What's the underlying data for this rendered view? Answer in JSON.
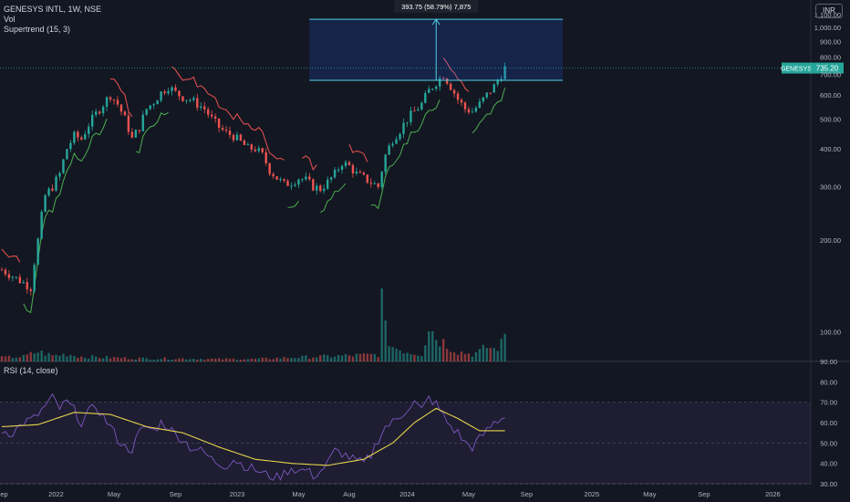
{
  "header": {
    "symbol_line": "GENESYS INTL, 1W, NSE",
    "vol_label": "Vol",
    "supertrend_label": "Supertrend (15, 3)",
    "currency": "INR"
  },
  "measure": {
    "label": "393.75 (58.79%) 7,875",
    "from_price": 670,
    "to_price": 1063
  },
  "price_tag": {
    "symbol": "GENESYS",
    "price": "735.20"
  },
  "colors": {
    "background": "#131722",
    "up": "#26a69a",
    "down": "#ef5350",
    "rsi_line": "#7e57c2",
    "rsi_ma": "#e5d44c",
    "measure": "#4dd0e1",
    "supertrend_up": "#4caf50",
    "supertrend_down": "#ef5350",
    "price_line": "#26a69a"
  },
  "rsi": {
    "label": "RSI (14, close)"
  },
  "chart_data": [
    {
      "type": "candlestick",
      "ylabel": "",
      "ylim": [
        80,
        1230
      ],
      "price_ticks": [
        "100.00",
        "200.00",
        "300.00",
        "400.00",
        "500.00",
        "600.00",
        "700.00",
        "800.00",
        "900.00",
        "1,000.00",
        "1,100.00",
        "1,200.00"
      ],
      "x_ticks": [
        "Sep",
        "2022",
        "May",
        "Sep",
        "2023",
        "May",
        "Aug",
        "2024",
        "May",
        "Sep",
        "2025",
        "May",
        "Sep",
        "2026"
      ],
      "x_tick_weeks": [
        0,
        15,
        31,
        48,
        65,
        82,
        96,
        112,
        129,
        145,
        163,
        179,
        194,
        213
      ],
      "weeks": 224,
      "last_price": 735.2,
      "grid": false,
      "close_points": [
        [
          0,
          160
        ],
        [
          4,
          150
        ],
        [
          8,
          140
        ],
        [
          10,
          200
        ],
        [
          12,
          280
        ],
        [
          14,
          300
        ],
        [
          16,
          330
        ],
        [
          18,
          400
        ],
        [
          20,
          440
        ],
        [
          22,
          430
        ],
        [
          24,
          480
        ],
        [
          26,
          520
        ],
        [
          28,
          560
        ],
        [
          30,
          600
        ],
        [
          32,
          560
        ],
        [
          34,
          500
        ],
        [
          36,
          430
        ],
        [
          38,
          470
        ],
        [
          40,
          540
        ],
        [
          42,
          570
        ],
        [
          44,
          610
        ],
        [
          46,
          640
        ],
        [
          48,
          610
        ],
        [
          50,
          590
        ],
        [
          52,
          580
        ],
        [
          54,
          560
        ],
        [
          56,
          540
        ],
        [
          58,
          500
        ],
        [
          60,
          470
        ],
        [
          62,
          450
        ],
        [
          64,
          440
        ],
        [
          66,
          420
        ],
        [
          68,
          400
        ],
        [
          70,
          400
        ],
        [
          72,
          380
        ],
        [
          74,
          340
        ],
        [
          76,
          320
        ],
        [
          78,
          305
        ],
        [
          80,
          310
        ],
        [
          82,
          320
        ],
        [
          84,
          315
        ],
        [
          86,
          300
        ],
        [
          88,
          295
        ],
        [
          90,
          310
        ],
        [
          92,
          330
        ],
        [
          94,
          360
        ],
        [
          96,
          350
        ],
        [
          98,
          330
        ],
        [
          100,
          320
        ],
        [
          102,
          310
        ],
        [
          104,
          300
        ],
        [
          106,
          380
        ],
        [
          108,
          430
        ],
        [
          110,
          460
        ],
        [
          112,
          500
        ],
        [
          114,
          530
        ],
        [
          116,
          560
        ],
        [
          118,
          620
        ],
        [
          120,
          660
        ],
        [
          122,
          700
        ],
        [
          124,
          640
        ],
        [
          126,
          580
        ],
        [
          128,
          540
        ],
        [
          130,
          530
        ],
        [
          132,
          560
        ],
        [
          134,
          600
        ],
        [
          136,
          640
        ],
        [
          138,
          700
        ],
        [
          139,
          735
        ]
      ],
      "volume_points": [
        [
          0,
          8
        ],
        [
          6,
          10
        ],
        [
          10,
          20
        ],
        [
          14,
          12
        ],
        [
          18,
          15
        ],
        [
          22,
          10
        ],
        [
          30,
          8
        ],
        [
          40,
          6
        ],
        [
          50,
          6
        ],
        [
          60,
          5
        ],
        [
          70,
          5
        ],
        [
          80,
          8
        ],
        [
          88,
          10
        ],
        [
          96,
          12
        ],
        [
          104,
          14
        ],
        [
          105,
          140
        ],
        [
          106,
          60
        ],
        [
          108,
          30
        ],
        [
          112,
          20
        ],
        [
          116,
          15
        ],
        [
          118,
          75
        ],
        [
          120,
          50
        ],
        [
          122,
          40
        ],
        [
          124,
          30
        ],
        [
          126,
          20
        ],
        [
          130,
          15
        ],
        [
          132,
          20
        ],
        [
          134,
          30
        ],
        [
          136,
          25
        ],
        [
          138,
          35
        ],
        [
          139,
          55
        ]
      ]
    },
    {
      "type": "line",
      "title": "",
      "ylim": [
        30,
        90
      ],
      "y_ticks": [
        "30.00",
        "40.00",
        "50.00",
        "60.00",
        "70.00",
        "80.00",
        "90.00"
      ],
      "series": [
        {
          "values": [
            [
              0,
              56
            ],
            [
              3,
              55
            ],
            [
              6,
              60
            ],
            [
              9,
              62
            ],
            [
              12,
              68
            ],
            [
              14,
              72
            ],
            [
              16,
              67
            ],
            [
              18,
              70
            ],
            [
              20,
              66
            ],
            [
              22,
              60
            ],
            [
              24,
              65
            ],
            [
              26,
              68
            ],
            [
              28,
              63
            ],
            [
              30,
              58
            ],
            [
              32,
              52
            ],
            [
              34,
              48
            ],
            [
              36,
              47
            ],
            [
              38,
              55
            ],
            [
              40,
              58
            ],
            [
              42,
              56
            ],
            [
              44,
              60
            ],
            [
              46,
              58
            ],
            [
              48,
              54
            ],
            [
              50,
              52
            ],
            [
              52,
              48
            ],
            [
              54,
              47
            ],
            [
              56,
              45
            ],
            [
              58,
              42
            ],
            [
              60,
              40
            ],
            [
              62,
              39
            ],
            [
              64,
              42
            ],
            [
              66,
              40
            ],
            [
              68,
              38
            ],
            [
              70,
              37
            ],
            [
              72,
              35
            ],
            [
              74,
              34
            ],
            [
              76,
              33
            ],
            [
              78,
              35
            ],
            [
              80,
              38
            ],
            [
              82,
              36
            ],
            [
              84,
              37
            ],
            [
              86,
              34
            ],
            [
              88,
              36
            ],
            [
              90,
              40
            ],
            [
              92,
              46
            ],
            [
              94,
              45
            ],
            [
              96,
              43
            ],
            [
              98,
              41
            ],
            [
              100,
              40
            ],
            [
              102,
              44
            ],
            [
              104,
              52
            ],
            [
              106,
              58
            ],
            [
              108,
              60
            ],
            [
              110,
              63
            ],
            [
              112,
              67
            ],
            [
              114,
              70
            ],
            [
              116,
              66
            ],
            [
              118,
              72
            ],
            [
              120,
              69
            ],
            [
              122,
              63
            ],
            [
              124,
              58
            ],
            [
              126,
              55
            ],
            [
              128,
              50
            ],
            [
              130,
              48
            ],
            [
              132,
              52
            ],
            [
              134,
              56
            ],
            [
              136,
              60
            ],
            [
              138,
              62
            ],
            [
              139,
              64
            ]
          ]
        },
        {
          "values": [
            [
              0,
              58
            ],
            [
              10,
              59
            ],
            [
              20,
              65
            ],
            [
              30,
              64
            ],
            [
              40,
              58
            ],
            [
              50,
              55
            ],
            [
              60,
              48
            ],
            [
              70,
              42
            ],
            [
              80,
              40
            ],
            [
              90,
              39
            ],
            [
              100,
              42
            ],
            [
              108,
              50
            ],
            [
              114,
              60
            ],
            [
              120,
              67
            ],
            [
              126,
              62
            ],
            [
              132,
              56
            ],
            [
              136,
              56
            ],
            [
              139,
              56
            ]
          ]
        }
      ]
    }
  ]
}
